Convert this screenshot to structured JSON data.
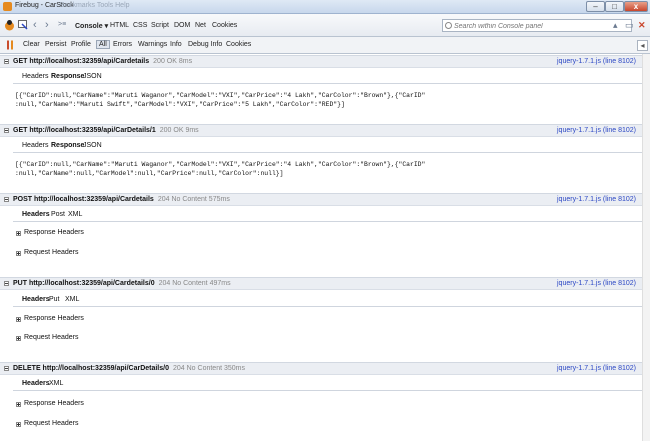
{
  "window": {
    "title": "Firebug - CarStock",
    "ghost_title": "Bookmarks   Tools   Help",
    "minimize": "–",
    "maximize": "□",
    "close": "x"
  },
  "toolbar": {
    "console_tab": "Console",
    "console_caret": "▾",
    "tabs": [
      "HTML",
      "CSS",
      "Script",
      "DOM",
      "Net",
      "Cookies"
    ],
    "search_placeholder": "Search within Console panel"
  },
  "filters": {
    "clear": "Clear",
    "persist": "Persist",
    "profile": "Profile",
    "items": [
      "All",
      "Errors",
      "Warnings",
      "Info",
      "Debug Info",
      "Cookies"
    ]
  },
  "entries": [
    {
      "method": "GET http://localhost:32359/api/Cardetails",
      "status": "200 OK 8ms",
      "source": "jquery-1.7.1.js (line 8102)",
      "tabs": [
        "Headers",
        "Response",
        "JSON"
      ],
      "selected_tab": "Response",
      "json": "[{\"CarID\":null,\"CarName\":\"Maruti Waganor\",\"CarModel\":\"VXI\",\"CarPrice\":\"4 Lakh\",\"CarColor\":\"Brown\"},{\"CarID\"\n:null,\"CarName\":\"Maruti Swift\",\"CarModel\":\"VXI\",\"CarPrice\":\"5 Lakh\",\"CarColor\":\"RED\"}]"
    },
    {
      "method": "GET http://localhost:32359/api/CarDetails/1",
      "status": "200 OK 9ms",
      "source": "jquery-1.7.1.js (line 8102)",
      "tabs": [
        "Headers",
        "Response",
        "JSON"
      ],
      "selected_tab": "Response",
      "json": "[{\"CarID\":null,\"CarName\":\"Maruti Waganor\",\"CarModel\":\"VXI\",\"CarPrice\":\"4 Lakh\",\"CarColor\":\"Brown\"},{\"CarID\"\n:null,\"CarName\":null,\"CarModel\":null,\"CarPrice\":null,\"CarColor\":null}]"
    },
    {
      "method": "POST http://localhost:32359/api/Cardetails",
      "status": "204 No Content 575ms",
      "source": "jquery-1.7.1.js (line 8102)",
      "tabs": [
        "Headers",
        "Post",
        "XML"
      ],
      "selected_tab": "Headers",
      "collapsibles": [
        "Response Headers",
        "Request Headers"
      ]
    },
    {
      "method": "PUT http://localhost:32359/api/Cardetails/0",
      "status": "204 No Content 497ms",
      "source": "jquery-1.7.1.js (line 8102)",
      "tabs": [
        "Headers",
        "Put",
        "XML"
      ],
      "selected_tab": "Headers",
      "collapsibles": [
        "Response Headers",
        "Request Headers"
      ]
    },
    {
      "method": "DELETE http://localhost:32359/api/CarDetails/0",
      "status": "204 No Content 350ms",
      "source": "jquery-1.7.1.js (line 8102)",
      "tabs": [
        "Headers",
        "XML"
      ],
      "selected_tab": "Headers",
      "collapsibles": [
        "Response Headers",
        "Request Headers"
      ]
    }
  ]
}
